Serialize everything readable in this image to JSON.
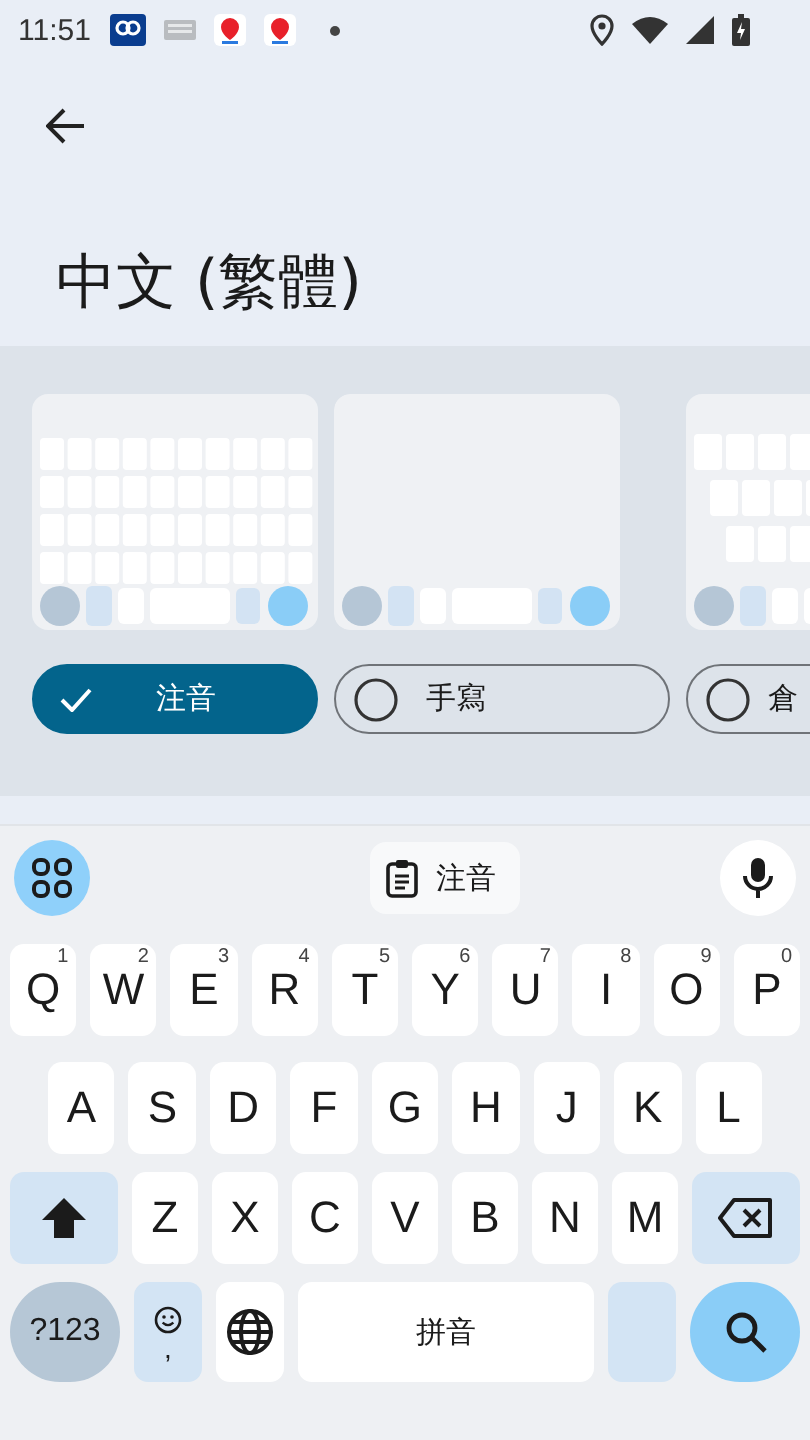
{
  "status_bar": {
    "time": "11:51"
  },
  "page": {
    "title": "中文 (繁體)"
  },
  "layouts": [
    {
      "label": "注音",
      "selected": true,
      "kind": "zhuyin"
    },
    {
      "label": "手寫",
      "selected": false,
      "kind": "handwriting"
    },
    {
      "label": "倉",
      "selected": false,
      "kind": "cangjie"
    }
  ],
  "keyboard": {
    "toolbar_label": "注音",
    "rows": [
      [
        {
          "kind": "letter",
          "label": "Q",
          "hint": "1"
        },
        {
          "kind": "letter",
          "label": "W",
          "hint": "2"
        },
        {
          "kind": "letter",
          "label": "E",
          "hint": "3"
        },
        {
          "kind": "letter",
          "label": "R",
          "hint": "4"
        },
        {
          "kind": "letter",
          "label": "T",
          "hint": "5"
        },
        {
          "kind": "letter",
          "label": "Y",
          "hint": "6"
        },
        {
          "kind": "letter",
          "label": "U",
          "hint": "7"
        },
        {
          "kind": "letter",
          "label": "I",
          "hint": "8"
        },
        {
          "kind": "letter",
          "label": "O",
          "hint": "9"
        },
        {
          "kind": "letter",
          "label": "P",
          "hint": "0"
        }
      ],
      [
        {
          "kind": "letter",
          "label": "A"
        },
        {
          "kind": "letter",
          "label": "S"
        },
        {
          "kind": "letter",
          "label": "D"
        },
        {
          "kind": "letter",
          "label": "F"
        },
        {
          "kind": "letter",
          "label": "G"
        },
        {
          "kind": "letter",
          "label": "H"
        },
        {
          "kind": "letter",
          "label": "J"
        },
        {
          "kind": "letter",
          "label": "K"
        },
        {
          "kind": "letter",
          "label": "L"
        }
      ],
      [
        {
          "kind": "shift"
        },
        {
          "kind": "letter",
          "label": "Z"
        },
        {
          "kind": "letter",
          "label": "X"
        },
        {
          "kind": "letter",
          "label": "C"
        },
        {
          "kind": "letter",
          "label": "V"
        },
        {
          "kind": "letter",
          "label": "B"
        },
        {
          "kind": "letter",
          "label": "N"
        },
        {
          "kind": "letter",
          "label": "M"
        },
        {
          "kind": "backspace"
        }
      ],
      [
        {
          "kind": "symbols",
          "label": "?123"
        },
        {
          "kind": "emoji",
          "label": ","
        },
        {
          "kind": "globe"
        },
        {
          "kind": "space",
          "label": "拼音"
        },
        {
          "kind": "blank"
        },
        {
          "kind": "search"
        }
      ]
    ]
  }
}
